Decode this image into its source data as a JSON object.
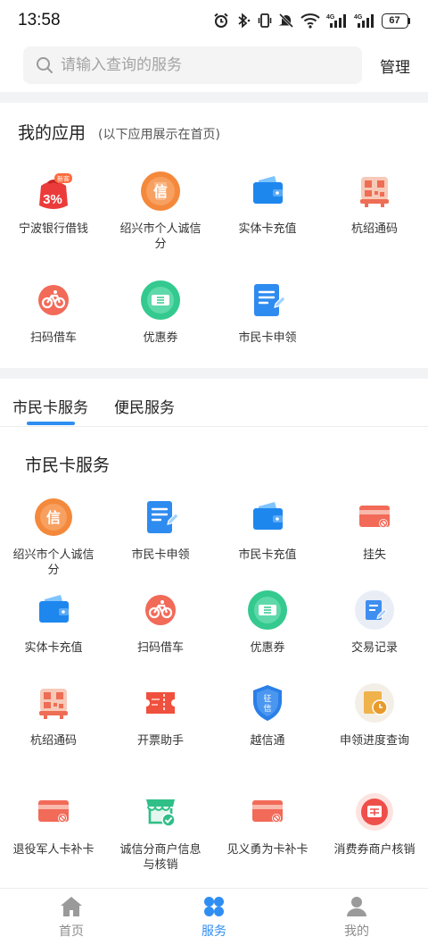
{
  "status_bar": {
    "time": "13:58",
    "battery": "67"
  },
  "search": {
    "placeholder": "请输入查询的服务",
    "manage_label": "管理"
  },
  "my_apps": {
    "title": "我的应用",
    "subtitle": "(以下应用展示在首页)",
    "items": [
      {
        "label": "宁波银行借钱",
        "icon": "ningbo-bank-loan-icon",
        "badge": "新客",
        "badge_value": "3%"
      },
      {
        "label": "绍兴市个人诚信分",
        "icon": "credit-score-icon"
      },
      {
        "label": "实体卡充值",
        "icon": "wallet-icon"
      },
      {
        "label": "杭绍通码",
        "icon": "qr-code-icon"
      },
      {
        "label": "扫码借车",
        "icon": "bike-icon"
      },
      {
        "label": "优惠券",
        "icon": "coupon-icon"
      },
      {
        "label": "市民卡申领",
        "icon": "apply-form-icon"
      }
    ]
  },
  "tabs": [
    {
      "label": "市民卡服务",
      "active": true
    },
    {
      "label": "便民服务",
      "active": false
    }
  ],
  "citizen_card": {
    "title": "市民卡服务",
    "items": [
      {
        "label": "绍兴市个人诚信分",
        "icon": "credit-score-icon"
      },
      {
        "label": "市民卡申领",
        "icon": "apply-form-icon"
      },
      {
        "label": "市民卡充值",
        "icon": "wallet-icon"
      },
      {
        "label": "挂失",
        "icon": "card-loss-icon"
      },
      {
        "label": "实体卡充值",
        "icon": "wallet-icon"
      },
      {
        "label": "扫码借车",
        "icon": "bike-icon"
      },
      {
        "label": "优惠券",
        "icon": "coupon-icon"
      },
      {
        "label": "交易记录",
        "icon": "transaction-record-icon"
      },
      {
        "label": "杭绍通码",
        "icon": "qr-code-icon"
      },
      {
        "label": "开票助手",
        "icon": "invoice-icon"
      },
      {
        "label": "越信通",
        "icon": "credit-shield-icon",
        "glyph_text": "征信"
      },
      {
        "label": "申领进度查询",
        "icon": "progress-query-icon"
      },
      {
        "label": "退役军人卡补卡",
        "icon": "card-replace-icon"
      },
      {
        "label": "诚信分商户信息与核销",
        "icon": "merchant-store-icon"
      },
      {
        "label": "见义勇为卡补卡",
        "icon": "card-replace-icon"
      },
      {
        "label": "消费券商户核销",
        "icon": "voucher-verify-icon"
      }
    ]
  },
  "bottom_nav": [
    {
      "label": "首页",
      "icon": "home-icon",
      "active": false
    },
    {
      "label": "服务",
      "icon": "services-icon",
      "active": true
    },
    {
      "label": "我的",
      "icon": "profile-icon",
      "active": false
    }
  ],
  "colors": {
    "accent": "#2f8ef2",
    "orange": "#f5883a",
    "red": "#f05a4a",
    "green": "#3ccf9a",
    "blue": "#2e8bef"
  }
}
